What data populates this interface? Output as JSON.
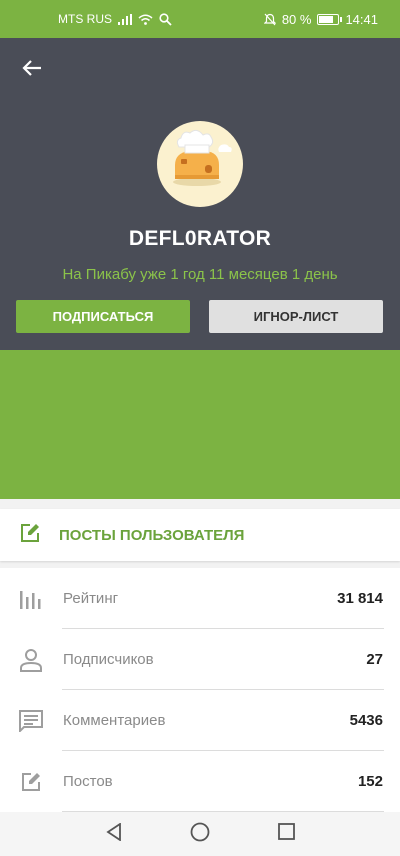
{
  "status_bar": {
    "carrier": "MTS RUS",
    "battery_percent": "80 %",
    "battery_level": 0.8,
    "time": "14:41"
  },
  "profile": {
    "username": "DEFL0RATOR",
    "member_since": "На Пикабу уже 1 год 11 месяцев 1 день",
    "subscribe_label": "ПОДПИСАТЬСЯ",
    "ignore_label": "ИГНОР-ЛИСТ"
  },
  "posts_link": {
    "label": "ПОСТЫ ПОЛЬЗОВАТЕЛЯ",
    "icon": "edit-icon"
  },
  "stats": [
    {
      "icon": "bar-chart-icon",
      "label": "Рейтинг",
      "value": "31 814"
    },
    {
      "icon": "person-icon",
      "label": "Подписчиков",
      "value": "27"
    },
    {
      "icon": "comment-icon",
      "label": "Комментариев",
      "value": "5436"
    },
    {
      "icon": "edit-icon",
      "label": "Постов",
      "value": "152"
    }
  ],
  "colors": {
    "accent_green": "#7cb342",
    "header_dark": "#4a4d57",
    "text_green": "#8bc34a"
  }
}
